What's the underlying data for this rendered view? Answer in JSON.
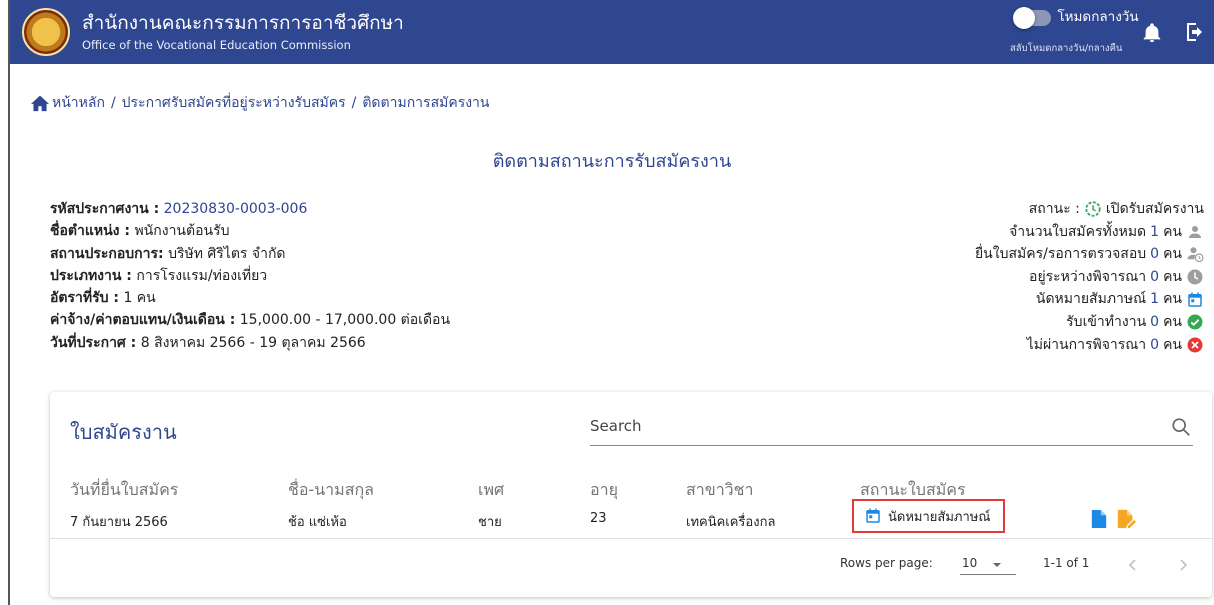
{
  "header": {
    "org_name_th": "สำนักงานคณะกรรมการการอาชีวศึกษา",
    "org_name_en": "Office of the Vocational Education Commission",
    "mode_title": "โหมดกลางวัน",
    "mode_subtitle": "สลับโหมดกลางวัน/กลางคืน",
    "bg_color": "#2f4690"
  },
  "breadcrumb": {
    "home": "หน้าหลัก",
    "sep": "/",
    "item1": "ประกาศรับสมัครที่อยู่ระหว่างรับสมัคร",
    "item2": "ติดตามการสมัครงาน"
  },
  "page_title": "ติดตามสถานะการรับสมัครงาน",
  "job": {
    "code_label": "รหัสประกาศงาน :",
    "code_value": "20230830-0003-006",
    "position_label": "ชื่อตำแหน่ง :",
    "position_value": "พนักงานต้อนรับ",
    "company_label": "สถานประกอบการ:",
    "company_value": "บริษัท ศิริไตร จำกัด",
    "type_label": "ประเภทงาน :",
    "type_value": "การโรงแรม/ท่องเที่ยว",
    "rate_label": "อัตราที่รับ :",
    "rate_value": "1 คน",
    "salary_label": "ค่าจ้าง/ค่าตอบแทน/เงินเดือน :",
    "salary_value": "15,000.00 - 17,000.00 ต่อเดือน",
    "date_label": "วันที่ประกาศ :",
    "date_value": "8 สิงหาคม 2566 - 19 ตุลาคม 2566"
  },
  "stats": {
    "status_label": "สถานะ :",
    "status_value": "เปิดรับสมัครงาน",
    "unit": "คน",
    "rows": [
      {
        "label": "จำนวนใบสมัครทั้งหมด",
        "count": "1",
        "icon": "person-icon"
      },
      {
        "label": "ยื่นใบสมัคร/รอการตรวจสอบ",
        "count": "0",
        "icon": "person-clock-icon"
      },
      {
        "label": "อยู่ระหว่างพิจารณา",
        "count": "0",
        "icon": "clock-icon"
      },
      {
        "label": "นัดหมายสัมภาษณ์",
        "count": "1",
        "icon": "calendar-icon"
      },
      {
        "label": "รับเข้าทำงาน",
        "count": "0",
        "icon": "check-circle-icon"
      },
      {
        "label": "ไม่ผ่านการพิจารณา",
        "count": "0",
        "icon": "cancel-circle-icon"
      }
    ]
  },
  "applications": {
    "title": "ใบสมัครงาน",
    "search_label": "Search",
    "columns": [
      "วันที่ยื่นใบสมัคร",
      "ชื่อ-นามสกุล",
      "เพศ",
      "อายุ",
      "สาขาวิชา",
      "สถานะใบสมัคร"
    ],
    "rows": [
      {
        "date": "7 กันยายน 2566",
        "name": "ช้อ แซ่เห้อ",
        "gender": "ชาย",
        "age": "23",
        "major": "เทคนิคเครื่องกล",
        "status": "นัดหมายสัมภาษณ์"
      }
    ],
    "pagination": {
      "rows_per_page_label": "Rows per page:",
      "rows_per_page": "10",
      "range": "1-1 of 1"
    }
  },
  "colors": {
    "accent": "#2f4690",
    "blue_icon": "#1e88e5",
    "orange_icon": "#f5a623",
    "green": "#34a853",
    "red": "#e53935",
    "grey_icon": "#9e9e9e"
  }
}
